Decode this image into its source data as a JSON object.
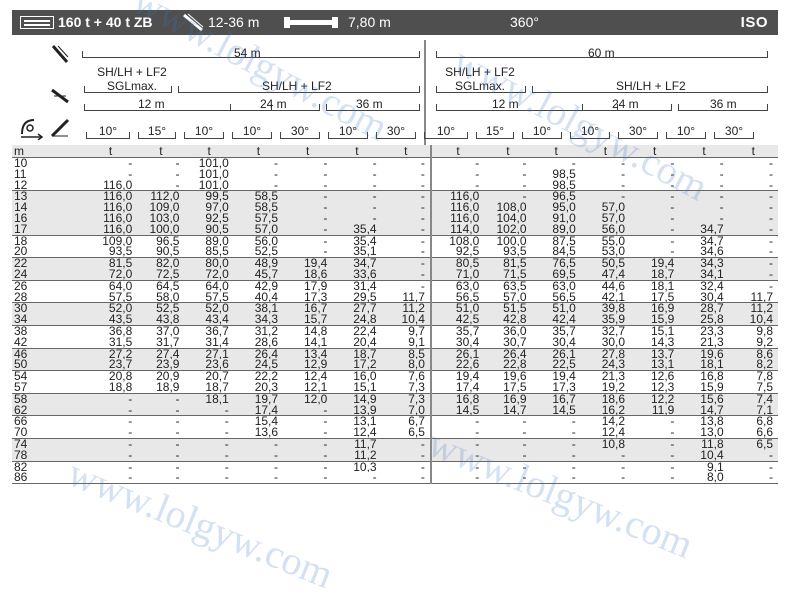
{
  "topbar": {
    "capacity": "160 t + 40 t ZB",
    "boom_range": "12-36 m",
    "outrigger_span": "7,80 m",
    "slew": "360°",
    "standard": "ISO"
  },
  "header": {
    "main_boom_left": "54 m",
    "main_boom_right": "60 m",
    "config_sgl": "SH/LH + LF2",
    "sgl_max": "SGLmax.",
    "config_jib": "SH/LH + LF2",
    "jib_lengths": [
      "12 m",
      "24 m",
      "36 m"
    ],
    "angles": [
      "10°",
      "15°",
      "10°",
      "10°",
      "30°",
      "10°",
      "30°",
      "10°",
      "15°",
      "10°",
      "10°",
      "30°",
      "10°",
      "30°"
    ]
  },
  "table": {
    "radius_unit": "m",
    "load_unit": "t",
    "rows": [
      {
        "r": "10",
        "v": [
          "-",
          "-",
          "101,0",
          "-",
          "-",
          "-",
          "-",
          "-",
          "-",
          "-",
          "-",
          "-",
          "-",
          "-"
        ]
      },
      {
        "r": "11",
        "v": [
          "-",
          "-",
          "101,0",
          "-",
          "-",
          "-",
          "-",
          "-",
          "-",
          "98,5",
          "-",
          "-",
          "-",
          "-"
        ]
      },
      {
        "r": "12",
        "v": [
          "116,0",
          "-",
          "101,0",
          "-",
          "-",
          "-",
          "-",
          "-",
          "-",
          "98,5",
          "-",
          "-",
          "-",
          "-"
        ]
      },
      {
        "r": "13",
        "v": [
          "116,0",
          "112,0",
          "99,5",
          "58,5",
          "-",
          "-",
          "-",
          "116,0",
          "-",
          "96,5",
          "-",
          "-",
          "-",
          "-"
        ]
      },
      {
        "r": "14",
        "v": [
          "116,0",
          "109,0",
          "97,0",
          "58,5",
          "-",
          "-",
          "-",
          "116,0",
          "108,0",
          "95,0",
          "57,0",
          "-",
          "-",
          "-"
        ]
      },
      {
        "r": "16",
        "v": [
          "116,0",
          "103,0",
          "92,5",
          "57,5",
          "-",
          "-",
          "-",
          "116,0",
          "104,0",
          "91,0",
          "57,0",
          "-",
          "-",
          "-"
        ]
      },
      {
        "r": "17",
        "v": [
          "116,0",
          "100,0",
          "90,5",
          "57,0",
          "-",
          "35,4",
          "-",
          "114,0",
          "102,0",
          "89,0",
          "56,0",
          "-",
          "34,7",
          "-"
        ]
      },
      {
        "r": "18",
        "v": [
          "109,0",
          "96,5",
          "89,0",
          "56,0",
          "-",
          "35,4",
          "-",
          "108,0",
          "100,0",
          "87,5",
          "55,0",
          "-",
          "34,7",
          "-"
        ]
      },
      {
        "r": "20",
        "v": [
          "93,5",
          "90,5",
          "85,5",
          "52,5",
          "-",
          "35,1",
          "-",
          "92,5",
          "93,5",
          "84,5",
          "53,0",
          "-",
          "34,6",
          "-"
        ]
      },
      {
        "r": "22",
        "v": [
          "81,5",
          "82,0",
          "80,0",
          "48,9",
          "19,4",
          "34,7",
          "-",
          "80,5",
          "81,5",
          "76,5",
          "50,5",
          "19,4",
          "34,3",
          "-"
        ]
      },
      {
        "r": "24",
        "v": [
          "72,0",
          "72,5",
          "72,0",
          "45,7",
          "18,6",
          "33,6",
          "-",
          "71,0",
          "71,5",
          "69,5",
          "47,4",
          "18,7",
          "34,1",
          "-"
        ]
      },
      {
        "r": "26",
        "v": [
          "64,0",
          "64,5",
          "64,0",
          "42,9",
          "17,9",
          "31,4",
          "-",
          "63,0",
          "63,5",
          "63,0",
          "44,6",
          "18,1",
          "32,4",
          "-"
        ]
      },
      {
        "r": "28",
        "v": [
          "57,5",
          "58,0",
          "57,5",
          "40,4",
          "17,3",
          "29,5",
          "11,7",
          "56,5",
          "57,0",
          "56,5",
          "42,1",
          "17,5",
          "30,4",
          "11,7"
        ]
      },
      {
        "r": "30",
        "v": [
          "52,0",
          "52,5",
          "52,0",
          "38,1",
          "16,7",
          "27,7",
          "11,2",
          "51,0",
          "51,5",
          "51,0",
          "39,8",
          "16,9",
          "28,7",
          "11,2"
        ]
      },
      {
        "r": "34",
        "v": [
          "43,5",
          "43,8",
          "43,4",
          "34,3",
          "15,7",
          "24,8",
          "10,4",
          "42,5",
          "42,8",
          "42,4",
          "35,9",
          "15,9",
          "25,8",
          "10,4"
        ]
      },
      {
        "r": "38",
        "v": [
          "36,8",
          "37,0",
          "36,7",
          "31,2",
          "14,8",
          "22,4",
          "9,7",
          "35,7",
          "36,0",
          "35,7",
          "32,7",
          "15,1",
          "23,3",
          "9,8"
        ]
      },
      {
        "r": "42",
        "v": [
          "31,5",
          "31,7",
          "31,4",
          "28,6",
          "14,1",
          "20,4",
          "9,1",
          "30,4",
          "30,7",
          "30,4",
          "30,0",
          "14,3",
          "21,3",
          "9,2"
        ]
      },
      {
        "r": "46",
        "v": [
          "27,2",
          "27,4",
          "27,1",
          "26,4",
          "13,4",
          "18,7",
          "8,5",
          "26,1",
          "26,4",
          "26,1",
          "27,8",
          "13,7",
          "19,6",
          "8,6"
        ]
      },
      {
        "r": "50",
        "v": [
          "23,7",
          "23,9",
          "23,6",
          "24,5",
          "12,9",
          "17,2",
          "8,0",
          "22,6",
          "22,8",
          "22,5",
          "24,3",
          "13,1",
          "18,1",
          "8,2"
        ]
      },
      {
        "r": "54",
        "v": [
          "20,8",
          "20,9",
          "20,7",
          "22,2",
          "12,4",
          "16,0",
          "7,6",
          "19,4",
          "19,6",
          "19,4",
          "21,3",
          "12,6",
          "16,8",
          "7,8"
        ]
      },
      {
        "r": "57",
        "v": [
          "18,8",
          "18,9",
          "18,7",
          "20,3",
          "12,1",
          "15,1",
          "7,3",
          "17,4",
          "17,5",
          "17,3",
          "19,2",
          "12,3",
          "15,9",
          "7,5"
        ]
      },
      {
        "r": "58",
        "v": [
          "-",
          "-",
          "18,1",
          "19,7",
          "12,0",
          "14,9",
          "7,3",
          "16,8",
          "16,9",
          "16,7",
          "18,6",
          "12,2",
          "15,6",
          "7,4"
        ]
      },
      {
        "r": "62",
        "v": [
          "-",
          "-",
          "-",
          "17,4",
          "-",
          "13,9",
          "7,0",
          "14,5",
          "14,7",
          "14,5",
          "16,2",
          "11,9",
          "14,7",
          "7,1"
        ]
      },
      {
        "r": "66",
        "v": [
          "-",
          "-",
          "-",
          "15,4",
          "-",
          "13,1",
          "6,7",
          "-",
          "-",
          "-",
          "14,2",
          "-",
          "13,8",
          "6,8"
        ]
      },
      {
        "r": "70",
        "v": [
          "-",
          "-",
          "-",
          "13,6",
          "-",
          "12,4",
          "6,5",
          "-",
          "-",
          "-",
          "12,4",
          "-",
          "13,0",
          "6,6"
        ]
      },
      {
        "r": "74",
        "v": [
          "-",
          "-",
          "-",
          "-",
          "-",
          "11,7",
          "-",
          "-",
          "-",
          "-",
          "10,8",
          "-",
          "11,8",
          "6,5"
        ]
      },
      {
        "r": "78",
        "v": [
          "-",
          "-",
          "-",
          "-",
          "-",
          "11,2",
          "-",
          "-",
          "-",
          "-",
          "-",
          "-",
          "10,4",
          "-"
        ]
      },
      {
        "r": "82",
        "v": [
          "-",
          "-",
          "-",
          "-",
          "-",
          "10,3",
          "-",
          "-",
          "-",
          "-",
          "-",
          "-",
          "9,1",
          "-"
        ]
      },
      {
        "r": "86",
        "v": [
          "-",
          "-",
          "-",
          "-",
          "-",
          "-",
          "-",
          "-",
          "-",
          "-",
          "-",
          "-",
          "8,0",
          "-"
        ]
      }
    ]
  },
  "watermark": "www.lolgyw.com",
  "colors": {
    "topbar_bg": "#4f4f4f",
    "shade": "#e8e8e8",
    "watermark": "#3c78c8"
  }
}
